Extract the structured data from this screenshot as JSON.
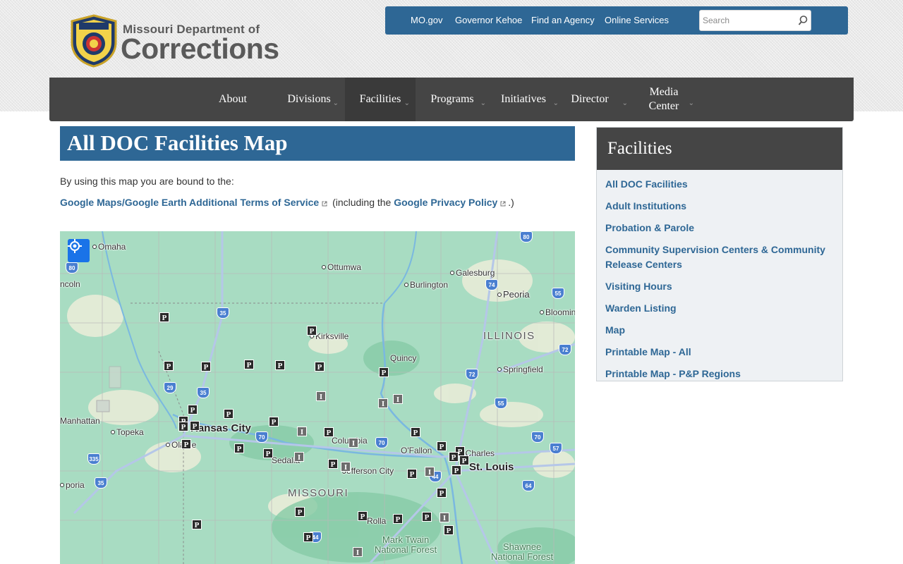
{
  "brand": {
    "line1": "Missouri Department of",
    "line2": "Corrections",
    "seal_text": "MISSOURI"
  },
  "utility": {
    "links": [
      "MO.gov",
      "Governor Kehoe",
      "Find an Agency",
      "Online Services"
    ],
    "search_placeholder": "Search"
  },
  "nav": {
    "items": [
      {
        "label": "About",
        "chevron": false
      },
      {
        "label": "Divisions",
        "chevron": true
      },
      {
        "label": "Facilities",
        "chevron": true,
        "active": true
      },
      {
        "label": "Programs",
        "chevron": true
      },
      {
        "label": "Initiatives",
        "chevron": true
      },
      {
        "label": "Director",
        "chevron": true
      },
      {
        "label": "Media Center",
        "chevron": true
      }
    ]
  },
  "page": {
    "title": "All DOC Facilities Map",
    "intro": "By using this map you are bound to the:",
    "terms_link": "Google Maps/Google Earth Additional Terms of Service",
    "terms_mid": "(including the",
    "privacy_link": "Google Privacy Policy",
    "terms_end": ".)"
  },
  "map": {
    "labels": {
      "omaha": "Omaha",
      "lincoln": "ncoln",
      "ottumwa": "Ottumwa",
      "galesburg": "Galesburg",
      "burlington": "Burlington",
      "peoria": "Peoria",
      "bloomington": "Bloomin",
      "kirksville": "Kirksville",
      "illinois": "ILLINOIS",
      "quincy": "Quincy",
      "springfield": "Springfield",
      "manhattan": "Manhattan",
      "topeka": "Topeka",
      "kansas_city": "Kansas City",
      "olathe": "Olathe",
      "columbia": "Columbia",
      "ofallon": "O'Fallon",
      "st_charles": "St Charles",
      "st_louis": "St. Louis",
      "sedalia": "Sedalia",
      "jefferson_city": "Jefferson City",
      "emporia": "poria",
      "missouri": "MISSOURI",
      "rolla": "Rolla",
      "mark_twain": "Mark Twain",
      "mark_twain2": "National Forest",
      "shawnee": "Shawnee",
      "shawnee2": "National Forest"
    },
    "shields": [
      "80",
      "35",
      "74",
      "55",
      "72",
      "29",
      "35",
      "72",
      "55",
      "70",
      "70",
      "70",
      "57",
      "335",
      "35",
      "44",
      "64",
      "44",
      "80"
    ],
    "markers": {
      "P": "P",
      "I": "I"
    }
  },
  "sidebar": {
    "title": "Facilities",
    "links": [
      "All DOC Facilities",
      "Adult Institutions",
      "Probation & Parole",
      "Community Supervision Centers & Community Release Centers",
      "Visiting Hours",
      "Warden Listing",
      "Map",
      "Printable Map - All",
      "Printable Map - P&P Regions"
    ]
  }
}
